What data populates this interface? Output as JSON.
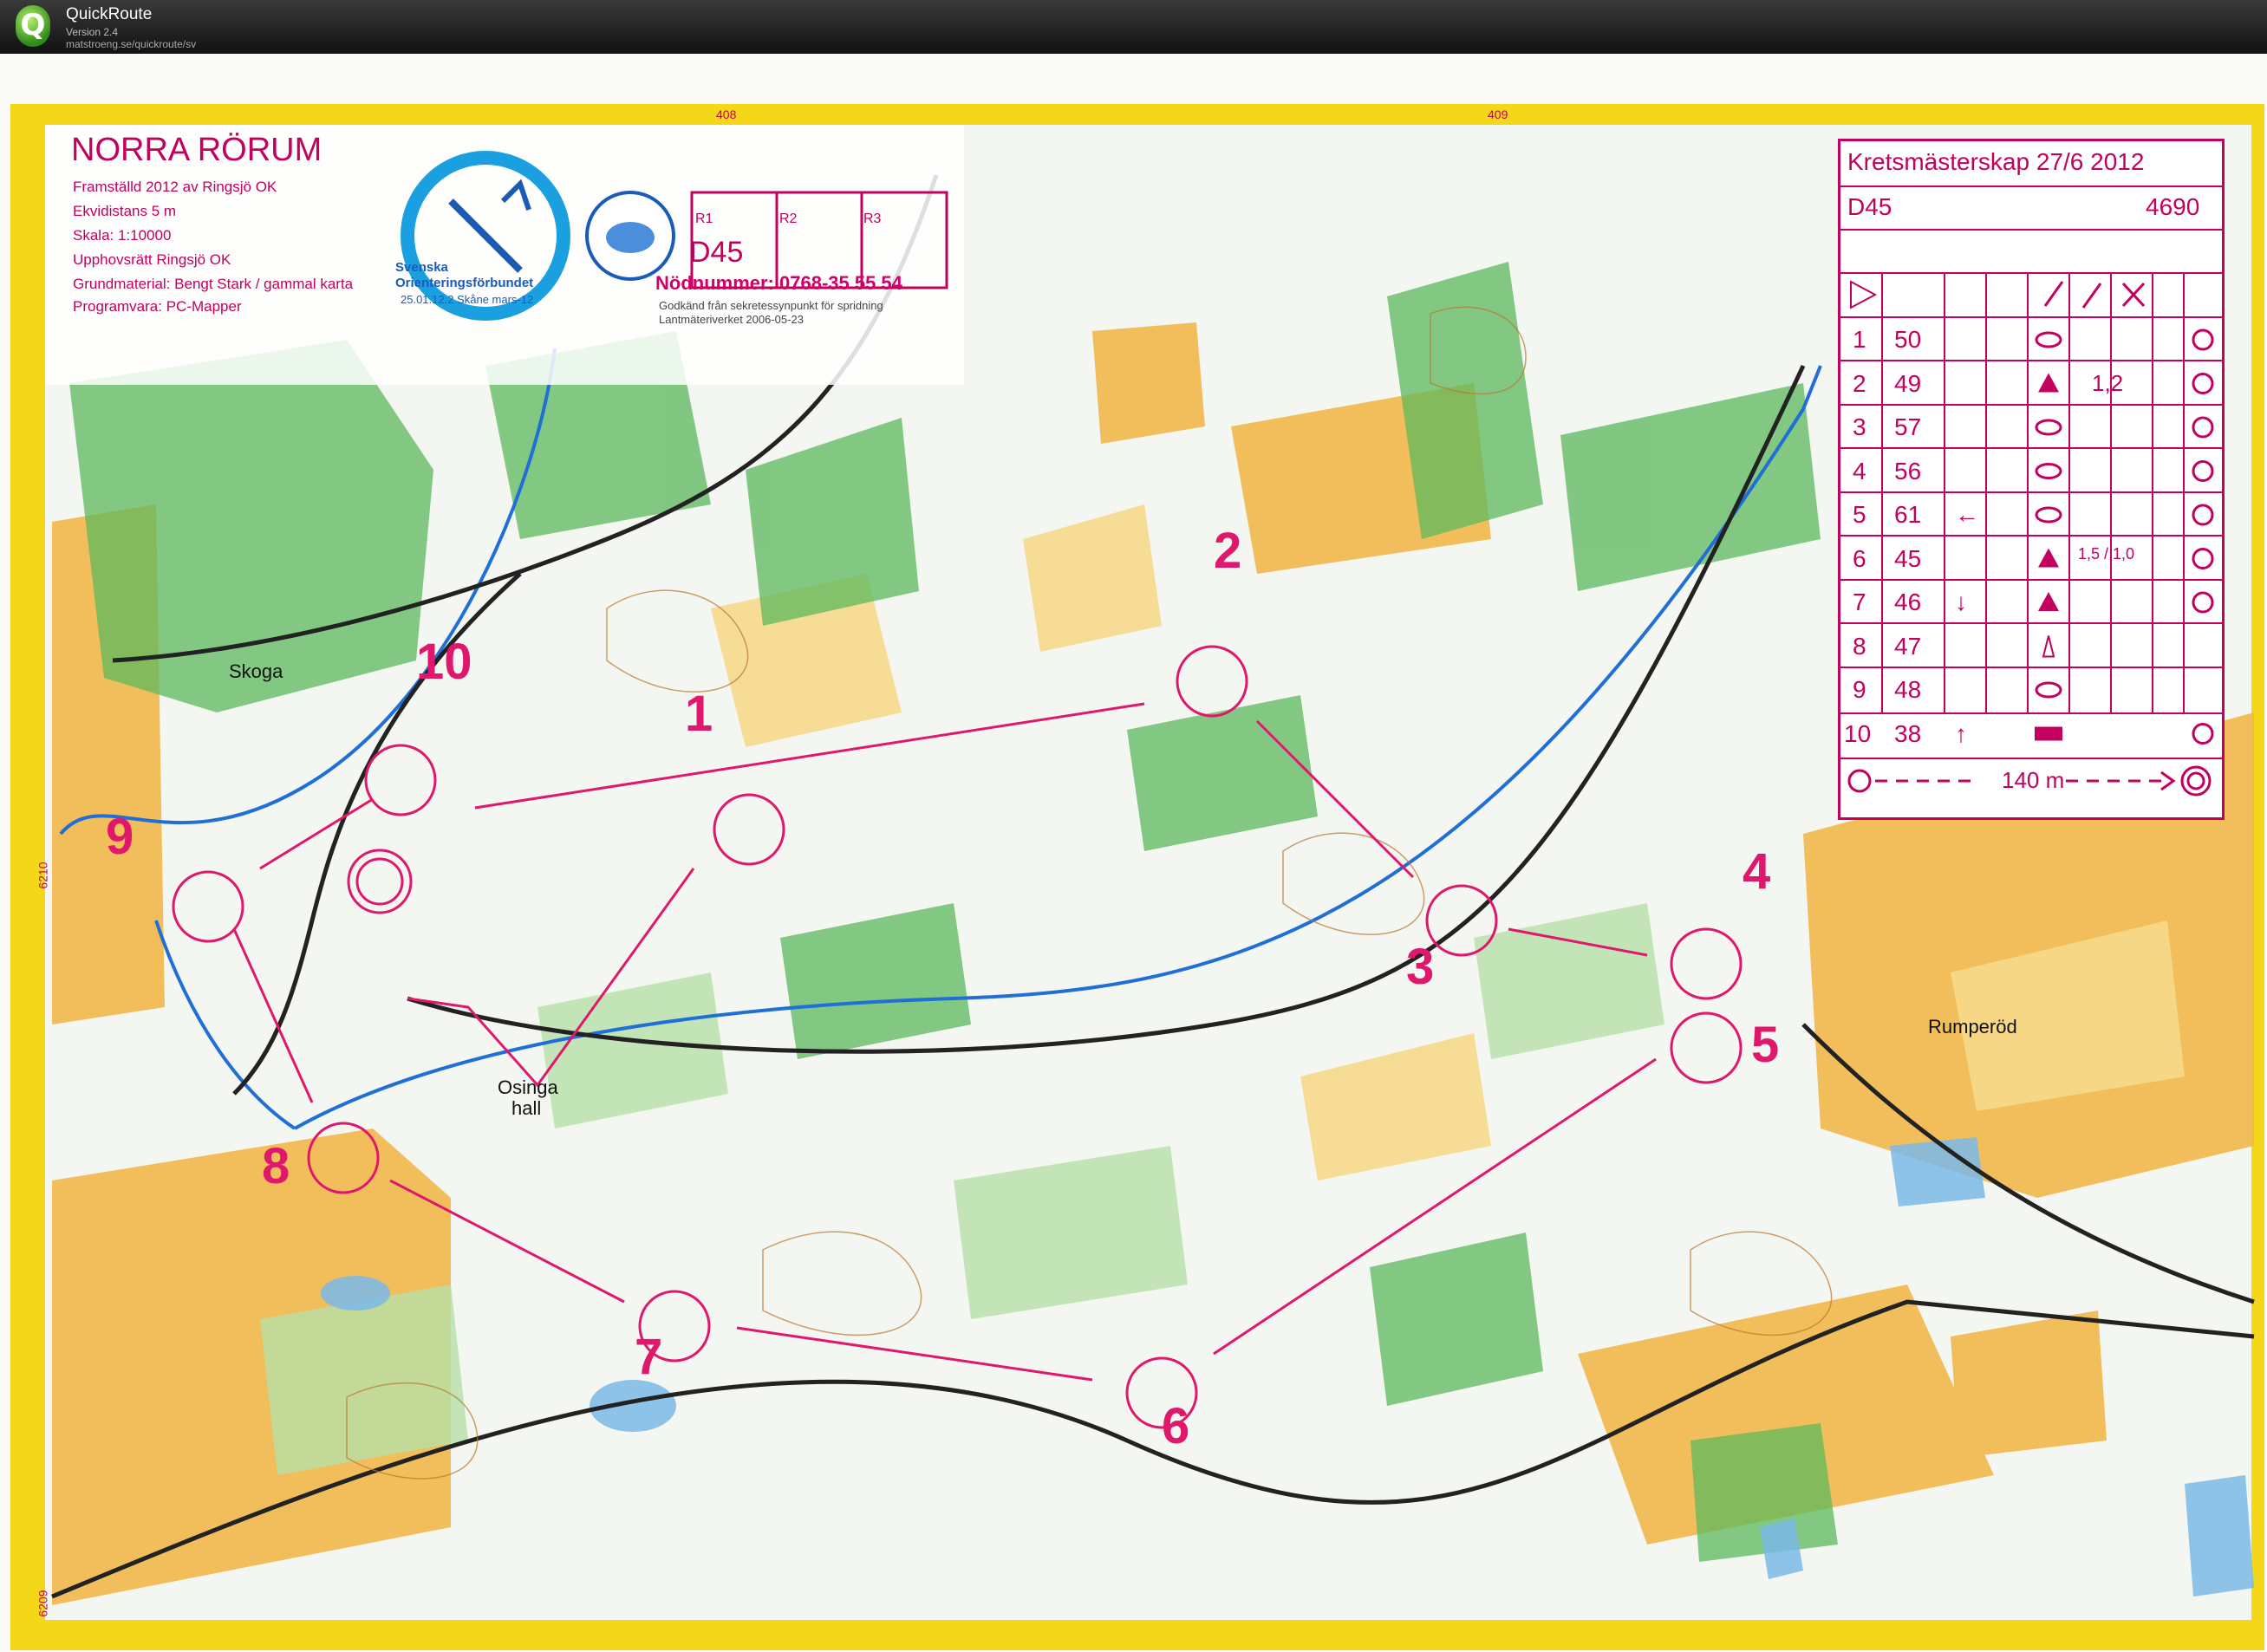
{
  "app": {
    "name": "QuickRoute",
    "version": "Version 2.4",
    "url": "matstroeng.se/quickroute/sv"
  },
  "map": {
    "title": "NORRA RÖRUM",
    "info_lines": [
      "Framställd 2012 av Ringsjö OK",
      "Ekvidistans 5 m",
      "Skala:   1:10000",
      "Upphovsrätt Ringsjö OK",
      "Grundmaterial: Bengt Stark / gammal karta",
      "Programvara: PC-Mapper"
    ],
    "federation": {
      "name_line1": "Svenska",
      "name_line2": "Orienteringsförbundet",
      "code": "25.01.12.2 Skåne mars-12"
    },
    "club_logo": "ringsjo-ok-logo",
    "relay_boxes": [
      "R1",
      "R2",
      "R3"
    ],
    "class": "D45",
    "emergency": "Nödnummer: 0768-35 55 54",
    "approval_lines": [
      "Godkänd från sekretessynpunkt för spridning",
      "Lantmäteriverket 2006-05-23"
    ],
    "grid_labels": [
      "408",
      "409",
      "6210",
      "6209"
    ],
    "place_names": [
      "Skoga",
      "Osinga",
      "hall",
      "Rumperöd"
    ],
    "controls": [
      "1",
      "2",
      "3",
      "4",
      "5",
      "6",
      "7",
      "8",
      "9",
      "10"
    ],
    "colors": {
      "course": "#e0186c",
      "forest_green": "#5cb85c",
      "open_yellow": "#f2b84b",
      "water_blue": "#1f6fd6",
      "border_yellow": "#f5d71a"
    }
  },
  "descriptions": {
    "event": "Kretsmästerskap 27/6 2012",
    "class": "D45",
    "length": "4690",
    "rows": [
      {
        "n": "1",
        "code": "50",
        "dir": "",
        "feat": "ellipse",
        "dim": "",
        "loc": "circle-top"
      },
      {
        "n": "2",
        "code": "49",
        "dir": "",
        "feat": "triangle",
        "dim": "1,2",
        "loc": "circle-top"
      },
      {
        "n": "3",
        "code": "57",
        "dir": "",
        "feat": "ellipse",
        "dim": "",
        "loc": "circle-bottom"
      },
      {
        "n": "4",
        "code": "56",
        "dir": "",
        "feat": "ellipse",
        "dim": "",
        "loc": "circle-bottom"
      },
      {
        "n": "5",
        "code": "61",
        "dir": "←",
        "feat": "ellipse",
        "dim": "",
        "loc": "circle-bottom"
      },
      {
        "n": "6",
        "code": "45",
        "dir": "",
        "feat": "triangle",
        "dim": "1,5 / 1,0",
        "loc": "circle-left"
      },
      {
        "n": "7",
        "code": "46",
        "dir": "↓",
        "feat": "triangle",
        "dim": "",
        "loc": "circle-top"
      },
      {
        "n": "8",
        "code": "47",
        "dir": "",
        "feat": "rock",
        "dim": "",
        "loc": ""
      },
      {
        "n": "9",
        "code": "48",
        "dir": "",
        "feat": "ellipse",
        "dim": "",
        "loc": ""
      },
      {
        "n": "10",
        "code": "38",
        "dir": "↑",
        "feat": "rect",
        "dim": "",
        "loc": "circle-top"
      }
    ],
    "finish": "140 m"
  }
}
